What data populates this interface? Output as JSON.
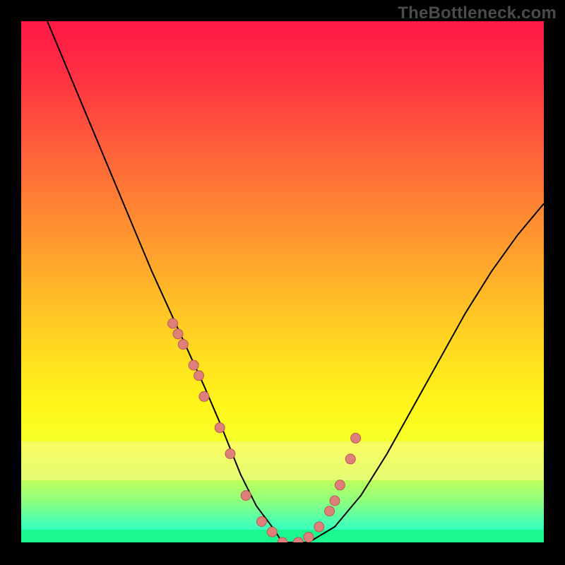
{
  "watermark": "TheBottleneck.com",
  "colors": {
    "gradient_stops": [
      {
        "offset": "0%",
        "color": "#ff1846"
      },
      {
        "offset": "10%",
        "color": "#ff2f42"
      },
      {
        "offset": "25%",
        "color": "#ff623a"
      },
      {
        "offset": "40%",
        "color": "#ff9230"
      },
      {
        "offset": "55%",
        "color": "#ffc226"
      },
      {
        "offset": "66%",
        "color": "#ffe31e"
      },
      {
        "offset": "74%",
        "color": "#fff71a"
      },
      {
        "offset": "80%",
        "color": "#f7ff26"
      },
      {
        "offset": "87%",
        "color": "#caff50"
      },
      {
        "offset": "92%",
        "color": "#8fff7e"
      },
      {
        "offset": "96%",
        "color": "#4cffb0"
      },
      {
        "offset": "100%",
        "color": "#18ffd0"
      }
    ],
    "yellow_band": "#fff98c",
    "green_bottom": "#1bf88f",
    "marker_fill": "#de7f7a"
  },
  "chart_data": {
    "type": "line",
    "title": "",
    "xlabel": "",
    "ylabel": "",
    "xlim": [
      0,
      100
    ],
    "ylim": [
      0,
      100
    ],
    "series": [
      {
        "name": "bottleneck-curve",
        "x": [
          5,
          10,
          15,
          20,
          25,
          30,
          35,
          38,
          40,
          42,
          45,
          48,
          50,
          55,
          60,
          65,
          70,
          75,
          80,
          85,
          90,
          95,
          100
        ],
        "y": [
          100,
          88,
          76,
          64,
          52,
          41,
          30,
          23,
          18,
          13,
          7,
          3,
          0,
          0,
          3,
          9,
          17,
          26,
          35,
          44,
          52,
          59,
          65
        ]
      }
    ],
    "markers": {
      "name": "sample-points",
      "x": [
        29,
        30,
        31,
        33,
        34,
        35,
        38,
        40,
        43,
        46,
        48,
        50,
        53,
        55,
        57,
        59,
        60,
        61,
        63,
        64
      ],
      "y": [
        42,
        40,
        38,
        34,
        32,
        28,
        22,
        17,
        9,
        4,
        2,
        0,
        0,
        1,
        3,
        6,
        8,
        11,
        16,
        20
      ]
    }
  }
}
